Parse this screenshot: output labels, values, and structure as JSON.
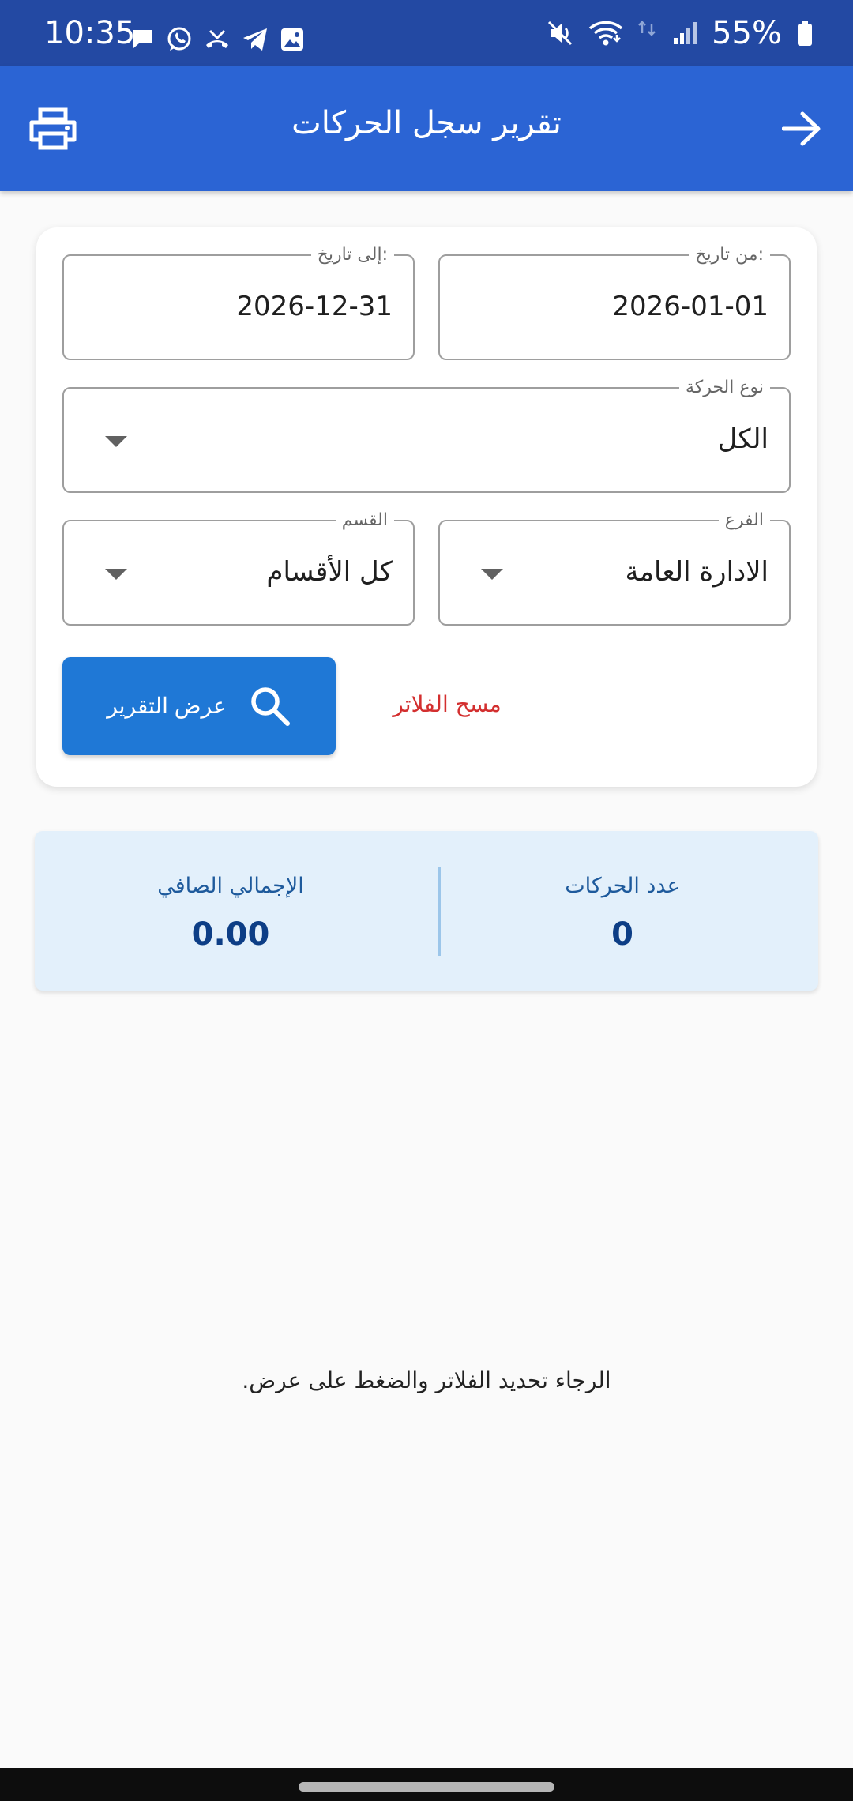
{
  "status_bar": {
    "time": "10:35",
    "battery": "55%",
    "left_icons": [
      "message-icon",
      "whatsapp-icon",
      "missed-call-icon",
      "telegram-icon",
      "image-icon"
    ],
    "right_icons": [
      "mute-icon",
      "wifi-icon",
      "data-icon",
      "signal-icon",
      "battery-icon"
    ]
  },
  "app_bar": {
    "title": "تقرير سجل الحركات",
    "left_icon": "print-icon",
    "right_icon": "arrow-forward-icon"
  },
  "filters": {
    "from_date": {
      "label": "من تاريخ:",
      "value": "2026-01-01"
    },
    "to_date": {
      "label": "إلى تاريخ:",
      "value": "2026-12-31"
    },
    "movement_type": {
      "label": "نوع الحركة",
      "value": "الكل"
    },
    "branch": {
      "label": "الفرع",
      "value": "الادارة العامة"
    },
    "department": {
      "label": "القسم",
      "value": "كل الأقسام"
    },
    "show_report_label": "عرض التقرير",
    "clear_filters_label": "مسح الفلاتر"
  },
  "summary": {
    "count_label": "عدد الحركات",
    "count_value": "0",
    "total_label": "الإجمالي الصافي",
    "total_value": "0.00"
  },
  "empty_message": "الرجاء تحديد الفلاتر والضغط على عرض.",
  "colors": {
    "status_bar": "#2349a3",
    "app_bar": "#2b64d4",
    "primary_button": "#1f78d6",
    "clear_text": "#d32f2f",
    "summary_bg": "#e3f0fb",
    "summary_value": "#0d3e86"
  }
}
